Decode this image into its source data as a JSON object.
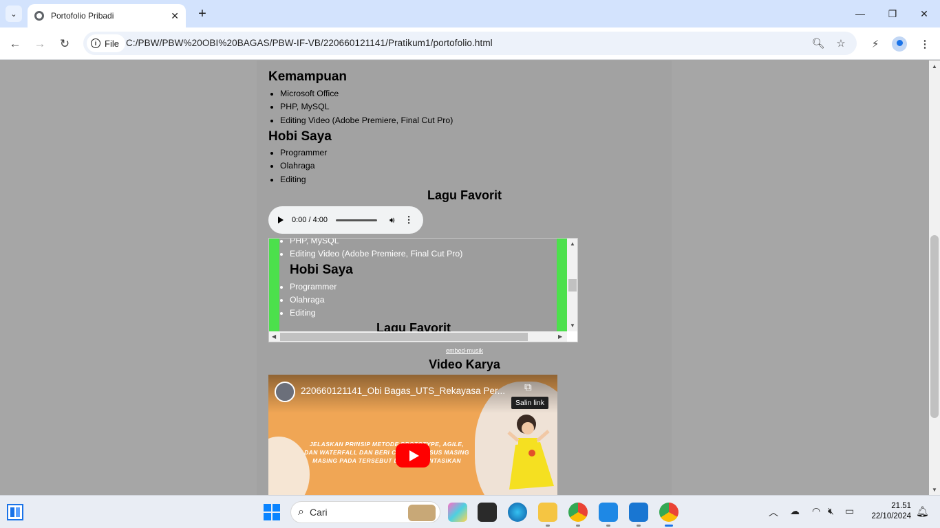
{
  "browser": {
    "tab_title": "Portofolio Pribadi",
    "tab_close": "✕",
    "new_tab": "+",
    "chip_label": "File",
    "url": "C:/PBW/PBW%20OBI%20BAGAS/PBW-IF-VB/220660121141/Pratikum1/portofolio.html"
  },
  "page": {
    "kemampuan_heading": "Kemampuan",
    "kemampuan_items": [
      "Microsoft Office",
      "PHP, MySQL",
      "Editing Video (Adobe Premiere, Final Cut Pro)"
    ],
    "hobi_heading": "Hobi Saya",
    "hobi_items": [
      "Programmer",
      "Olahraga",
      "Editing"
    ],
    "lagu_heading": "Lagu Favorit",
    "audio_time": "0:00 / 4:00",
    "iframe": {
      "items_top": [
        "PHP, MySQL",
        "Editing Video (Adobe Premiere, Final Cut Pro)"
      ],
      "hobi_heading": "Hobi Saya",
      "hobi_items": [
        "Programmer",
        "Olahraga",
        "Editing"
      ],
      "lagu_heading": "Lagu Favorit"
    },
    "embed_link": "embed-musik",
    "video_heading": "Video Karya",
    "video": {
      "title": "220660121141_Obi Bagas_UTS_Rekayasa Per...",
      "copy_tooltip": "Salin link",
      "overlay_text": "JELASKAN PRINSIP METODE PROTOTYPE, AGILE, DAN WATERFALL DAN BERI CONTOH KASUS MASING MASING PADA TERSEBUT DIIMPLEMENTASIKAN"
    }
  },
  "taskbar": {
    "search_placeholder": "Cari",
    "time": "21.51",
    "date": "22/10/2024"
  },
  "colors": {
    "iframe_side": "#4ce04c",
    "yt_red": "#ff0000",
    "video_bg": "#f0a655"
  }
}
